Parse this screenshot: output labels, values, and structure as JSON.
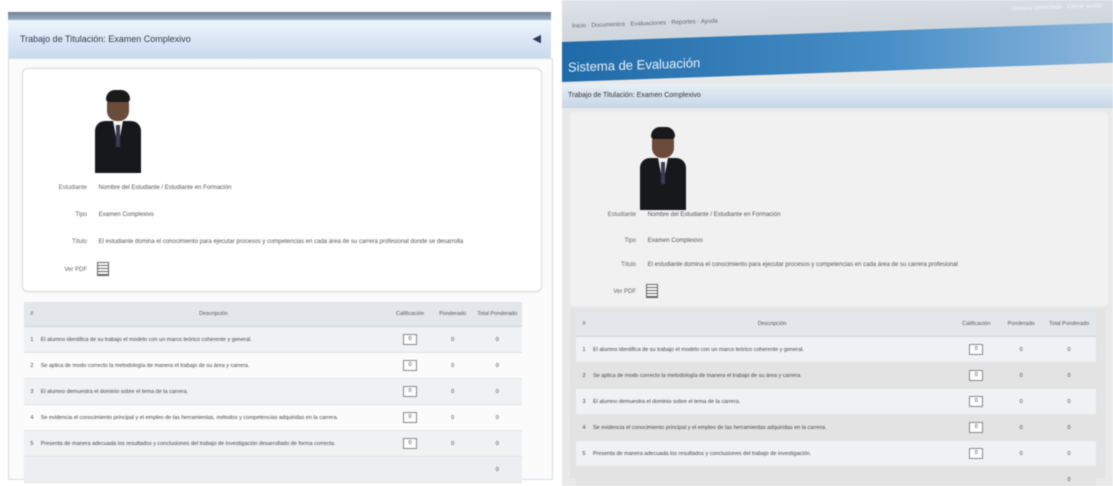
{
  "left": {
    "panel_title": "Trabajo de Titulación: Examen Complexivo",
    "collapse_icon": "chevron-icon",
    "profile": {
      "fields": [
        {
          "label": "Estudiante",
          "value": "Nombre del Estudiante / Estudiante en Formación"
        },
        {
          "label": "Tipo",
          "value": "Examen Complexivo"
        },
        {
          "label": "Título",
          "value": "El estudiante domina el conocimiento para ejecutar procesos y competencias en cada área de su carrera profesional donde se desarrolla"
        },
        {
          "label": "Ver PDF",
          "value": ""
        }
      ]
    },
    "table": {
      "headers": [
        "#",
        "Descripción",
        "Calificación",
        "Ponderado",
        "Total Ponderado"
      ],
      "rows": [
        {
          "n": "1",
          "desc": "El alumno identifica de su trabajo el modelo con un marco teórico coherente y general.",
          "score": "0",
          "weight": "0",
          "total": "0"
        },
        {
          "n": "2",
          "desc": "Se aplica de modo correcto la metodología de manera el trabajo de su área y carrera.",
          "score": "0",
          "weight": "0",
          "total": "0"
        },
        {
          "n": "3",
          "desc": "El alumno demuestra el dominio sobre el tema de la carrera.",
          "score": "0",
          "weight": "0",
          "total": "0"
        },
        {
          "n": "4",
          "desc": "Se evidencia el conocimiento principal y el empleo de las herramientas, métodos y competencias adquiridas en la carrera.",
          "score": "0",
          "weight": "0",
          "total": "0"
        },
        {
          "n": "5",
          "desc": "Presenta de manera adecuada los resultados y conclusiones del trabajo de investigación desarrollado de forma correcta.",
          "score": "0",
          "weight": "0",
          "total": "0"
        }
      ],
      "footer": "0"
    }
  },
  "right": {
    "toolbar_items": "Inicio · Documentos · Evaluaciones · Reportes · Ayuda",
    "toolbar_right": "Usuario conectado · Cerrar sesión",
    "banner_title": "Sistema de Evaluación",
    "panel_title": "Trabajo de Titulación: Examen Complexivo",
    "profile": {
      "fields": [
        {
          "label": "Estudiante",
          "value": "Nombre del Estudiante / Estudiante en Formación"
        },
        {
          "label": "Tipo",
          "value": "Examen Complexivo"
        },
        {
          "label": "Título",
          "value": "El estudiante domina el conocimiento para ejecutar procesos y competencias en cada área de su carrera profesional"
        },
        {
          "label": "Ver PDF",
          "value": ""
        }
      ]
    },
    "table": {
      "headers": [
        "#",
        "Descripción",
        "Calificación",
        "Ponderado",
        "Total Ponderado"
      ],
      "rows": [
        {
          "n": "1",
          "desc": "El alumno identifica de su trabajo el modelo con un marco teórico coherente y general.",
          "score": "0",
          "weight": "0",
          "total": "0"
        },
        {
          "n": "2",
          "desc": "Se aplica de modo correcto la metodología de manera el trabajo de su área y carrera.",
          "score": "0",
          "weight": "0",
          "total": "0"
        },
        {
          "n": "3",
          "desc": "El alumno demuestra el dominio sobre el tema de la carrera.",
          "score": "0",
          "weight": "0",
          "total": "0"
        },
        {
          "n": "4",
          "desc": "Se evidencia el conocimiento principal y el empleo de las herramientas adquiridas en la carrera.",
          "score": "0",
          "weight": "0",
          "total": "0"
        },
        {
          "n": "5",
          "desc": "Presenta de manera adecuada los resultados y conclusiones del trabajo de investigación.",
          "score": "0",
          "weight": "0",
          "total": "0"
        }
      ],
      "footer": "0"
    }
  }
}
